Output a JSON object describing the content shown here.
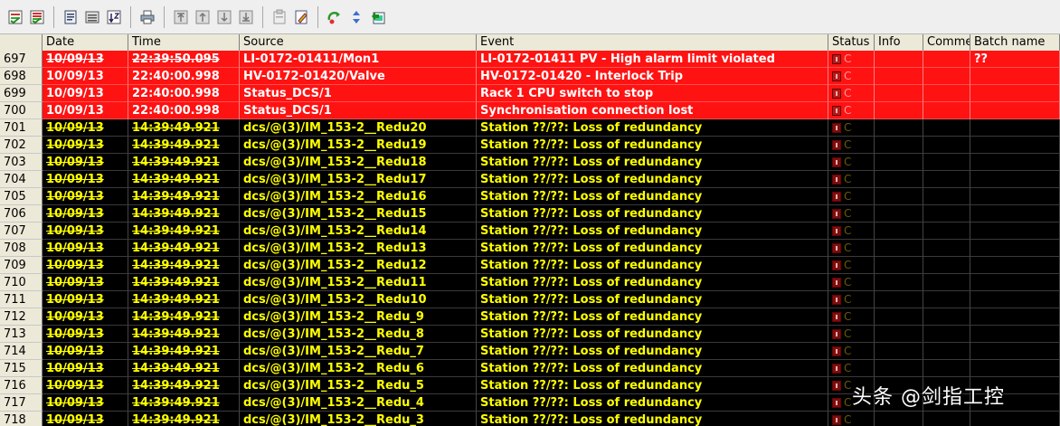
{
  "toolbar": {
    "icons": [
      "ack-selected-icon",
      "ack-all-icon",
      "properties-icon",
      "filter-icon",
      "sort-icon",
      "print-icon",
      "scroll-first-icon",
      "scroll-up-icon",
      "scroll-down-icon",
      "scroll-last-icon",
      "archive-icon",
      "edit-note-icon",
      "refresh-icon",
      "up-down-icon",
      "export-icon"
    ]
  },
  "columns": [
    "",
    "Date",
    "Time",
    "Source",
    "Event",
    "Status",
    "Info",
    "Comme",
    "Batch name"
  ],
  "rows": [
    {
      "idx": "697",
      "date": "10/09/13",
      "time": "22:39:50.095",
      "source": "LI-0172-01411/Mon1",
      "event": "LI-0172-01411 PV - High alarm limit violated",
      "status": "C",
      "info": "",
      "comment": "",
      "batch": "??",
      "style": "red",
      "strike": true
    },
    {
      "idx": "698",
      "date": "10/09/13",
      "time": "22:40:00.998",
      "source": "HV-0172-01420/Valve",
      "event": "HV-0172-01420 - Interlock Trip",
      "status": "C",
      "info": "",
      "comment": "",
      "batch": "",
      "style": "red",
      "strike": false
    },
    {
      "idx": "699",
      "date": "10/09/13",
      "time": "22:40:00.998",
      "source": "Status_DCS/1",
      "event": "Rack 1 CPU switch to stop",
      "status": "C",
      "info": "",
      "comment": "",
      "batch": "",
      "style": "red",
      "strike": false
    },
    {
      "idx": "700",
      "date": "10/09/13",
      "time": "22:40:00.998",
      "source": "Status_DCS/1",
      "event": "Synchronisation connection lost",
      "status": "C",
      "info": "",
      "comment": "",
      "batch": "",
      "style": "red",
      "strike": false
    },
    {
      "idx": "701",
      "date": "10/09/13",
      "time": "14:39:49.921",
      "source": "dcs/@(3)/IM_153-2__Redu20",
      "event": "Station ??/??: Loss of redundancy",
      "status": "C",
      "info": "",
      "comment": "",
      "batch": "",
      "style": "black",
      "strike": true
    },
    {
      "idx": "702",
      "date": "10/09/13",
      "time": "14:39:49.921",
      "source": "dcs/@(3)/IM_153-2__Redu19",
      "event": "Station ??/??: Loss of redundancy",
      "status": "C",
      "info": "",
      "comment": "",
      "batch": "",
      "style": "black",
      "strike": true
    },
    {
      "idx": "703",
      "date": "10/09/13",
      "time": "14:39:49.921",
      "source": "dcs/@(3)/IM_153-2__Redu18",
      "event": "Station ??/??: Loss of redundancy",
      "status": "C",
      "info": "",
      "comment": "",
      "batch": "",
      "style": "black",
      "strike": true
    },
    {
      "idx": "704",
      "date": "10/09/13",
      "time": "14:39:49.921",
      "source": "dcs/@(3)/IM_153-2__Redu17",
      "event": "Station ??/??: Loss of redundancy",
      "status": "C",
      "info": "",
      "comment": "",
      "batch": "",
      "style": "black",
      "strike": true
    },
    {
      "idx": "705",
      "date": "10/09/13",
      "time": "14:39:49.921",
      "source": "dcs/@(3)/IM_153-2__Redu16",
      "event": "Station ??/??: Loss of redundancy",
      "status": "C",
      "info": "",
      "comment": "",
      "batch": "",
      "style": "black",
      "strike": true
    },
    {
      "idx": "706",
      "date": "10/09/13",
      "time": "14:39:49.921",
      "source": "dcs/@(3)/IM_153-2__Redu15",
      "event": "Station ??/??: Loss of redundancy",
      "status": "C",
      "info": "",
      "comment": "",
      "batch": "",
      "style": "black",
      "strike": true
    },
    {
      "idx": "707",
      "date": "10/09/13",
      "time": "14:39:49.921",
      "source": "dcs/@(3)/IM_153-2__Redu14",
      "event": "Station ??/??: Loss of redundancy",
      "status": "C",
      "info": "",
      "comment": "",
      "batch": "",
      "style": "black",
      "strike": true
    },
    {
      "idx": "708",
      "date": "10/09/13",
      "time": "14:39:49.921",
      "source": "dcs/@(3)/IM_153-2__Redu13",
      "event": "Station ??/??: Loss of redundancy",
      "status": "C",
      "info": "",
      "comment": "",
      "batch": "",
      "style": "black",
      "strike": true
    },
    {
      "idx": "709",
      "date": "10/09/13",
      "time": "14:39:49.921",
      "source": "dcs/@(3)/IM_153-2__Redu12",
      "event": "Station ??/??: Loss of redundancy",
      "status": "C",
      "info": "",
      "comment": "",
      "batch": "",
      "style": "black",
      "strike": true
    },
    {
      "idx": "710",
      "date": "10/09/13",
      "time": "14:39:49.921",
      "source": "dcs/@(3)/IM_153-2__Redu11",
      "event": "Station ??/??: Loss of redundancy",
      "status": "C",
      "info": "",
      "comment": "",
      "batch": "",
      "style": "black",
      "strike": true
    },
    {
      "idx": "711",
      "date": "10/09/13",
      "time": "14:39:49.921",
      "source": "dcs/@(3)/IM_153-2__Redu10",
      "event": "Station ??/??: Loss of redundancy",
      "status": "C",
      "info": "",
      "comment": "",
      "batch": "",
      "style": "black",
      "strike": true
    },
    {
      "idx": "712",
      "date": "10/09/13",
      "time": "14:39:49.921",
      "source": "dcs/@(3)/IM_153-2__Redu_9",
      "event": "Station ??/??: Loss of redundancy",
      "status": "C",
      "info": "",
      "comment": "",
      "batch": "",
      "style": "black",
      "strike": true
    },
    {
      "idx": "713",
      "date": "10/09/13",
      "time": "14:39:49.921",
      "source": "dcs/@(3)/IM_153-2__Redu_8",
      "event": "Station ??/??: Loss of redundancy",
      "status": "C",
      "info": "",
      "comment": "",
      "batch": "",
      "style": "black",
      "strike": true
    },
    {
      "idx": "714",
      "date": "10/09/13",
      "time": "14:39:49.921",
      "source": "dcs/@(3)/IM_153-2__Redu_7",
      "event": "Station ??/??: Loss of redundancy",
      "status": "C",
      "info": "",
      "comment": "",
      "batch": "",
      "style": "black",
      "strike": true
    },
    {
      "idx": "715",
      "date": "10/09/13",
      "time": "14:39:49.921",
      "source": "dcs/@(3)/IM_153-2__Redu_6",
      "event": "Station ??/??: Loss of redundancy",
      "status": "C",
      "info": "",
      "comment": "",
      "batch": "",
      "style": "black",
      "strike": true
    },
    {
      "idx": "716",
      "date": "10/09/13",
      "time": "14:39:49.921",
      "source": "dcs/@(3)/IM_153-2__Redu_5",
      "event": "Station ??/??: Loss of redundancy",
      "status": "C",
      "info": "",
      "comment": "",
      "batch": "",
      "style": "black",
      "strike": true
    },
    {
      "idx": "717",
      "date": "10/09/13",
      "time": "14:39:49.921",
      "source": "dcs/@(3)/IM_153-2__Redu_4",
      "event": "Station ??/??: Loss of redundancy",
      "status": "C",
      "info": "",
      "comment": "",
      "batch": "",
      "style": "black",
      "strike": true
    },
    {
      "idx": "718",
      "date": "10/09/13",
      "time": "14:39:49.921",
      "source": "dcs/@(3)/IM_153-2__Redu_3",
      "event": "Station ??/??: Loss of redundancy",
      "status": "C",
      "info": "",
      "comment": "",
      "batch": "",
      "style": "black",
      "strike": true
    }
  ],
  "colors": {
    "alarm_row_bg": "#ff1212",
    "alarm_row_text": "#ffffff",
    "event_row_bg": "#000000",
    "event_row_text": "#ffff00",
    "header_bg": "#ece9d8"
  },
  "watermark": "头条 @剑指工控"
}
